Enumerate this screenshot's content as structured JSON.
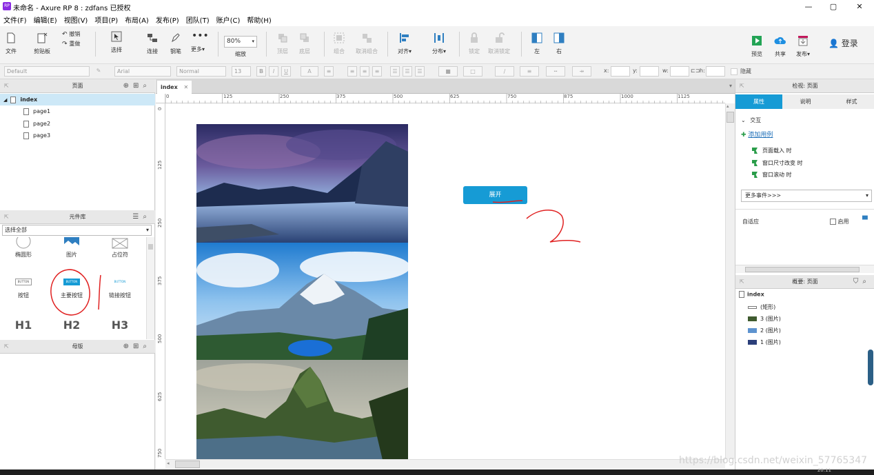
{
  "window": {
    "title": "未命名 - Axure RP 8 : zdfans 已授权",
    "app_icon": "RP",
    "minimize_glyph": "—",
    "maximize_glyph": "▢",
    "close_glyph": "✕"
  },
  "menu": [
    "文件(F)",
    "编辑(E)",
    "视图(V)",
    "项目(P)",
    "布局(A)",
    "发布(P)",
    "团队(T)",
    "账户(C)",
    "帮助(H)"
  ],
  "toolbar": {
    "file": "文件",
    "clipboard": "剪贴板",
    "undo": "撤销",
    "redo": "重做",
    "select": "选择",
    "connect": "连接",
    "pen": "钢笔",
    "more": "更多▾",
    "zoom_value": "80%",
    "zoom_label": "缩放",
    "top": "顶层",
    "bottom": "底层",
    "group": "组合",
    "ungroup": "取消组合",
    "align": "对齐▾",
    "distribute": "分布▾",
    "lock": "锁定",
    "unlock": "取消锁定",
    "left": "左",
    "right": "右",
    "preview": "预览",
    "share": "共享",
    "publish": "发布▾",
    "login": "登录"
  },
  "format": {
    "style": "Default",
    "font": "Arial",
    "weight": "Normal",
    "size": "13",
    "bold": "B",
    "italic": "I",
    "underline": "U",
    "text_color": "A",
    "x_label": "x:",
    "y_label": "y:",
    "w_label": "w:",
    "h_label": "h:",
    "hide_label": "隐藏"
  },
  "pages_panel": {
    "title": "页面",
    "items": [
      {
        "label": "index"
      },
      {
        "label": "page1"
      },
      {
        "label": "page2"
      },
      {
        "label": "page3"
      }
    ]
  },
  "library_panel": {
    "title": "元件库",
    "filter": "选择全部",
    "row1": [
      "椭圆形",
      "图片",
      "占位符"
    ],
    "row2": [
      "按钮",
      "主要按钮",
      "链接按钮"
    ],
    "button_preview": "BUTTON",
    "headings": [
      "H1",
      "H2",
      "H3"
    ]
  },
  "masters_panel": {
    "title": "母版"
  },
  "canvas": {
    "tab": "index",
    "tab_close": "✕",
    "h_ticks": [
      "0",
      "125",
      "250",
      "375",
      "500",
      "625",
      "750",
      "875",
      "1000",
      "1125"
    ],
    "v_ticks": [
      "0",
      "125",
      "250",
      "375",
      "500",
      "625",
      "750"
    ],
    "expand_button": "展开",
    "annotation": "2"
  },
  "inspector": {
    "title": "检视: 页面",
    "tabs": [
      "属性",
      "说明",
      "样式"
    ],
    "interaction_header": "交互",
    "add_case": "添加用例",
    "events": [
      "页面载入 时",
      "窗口尺寸改变 时",
      "窗口滚动 时"
    ],
    "more_events": "更多事件>>>",
    "adaptive": "自适应",
    "enable": "启用"
  },
  "outline": {
    "title": "概要: 页面",
    "root": "index",
    "items": [
      "(矩形)",
      "3 (图片)",
      "2 (图片)",
      "1 (图片)"
    ]
  },
  "watermark": "https://blog.csdn.net/weixin_57765347",
  "taskbar_time": "20:11",
  "colors": {
    "accent": "#169bd5",
    "annotation": "#e02020",
    "selected_row": "#cde8f7"
  }
}
